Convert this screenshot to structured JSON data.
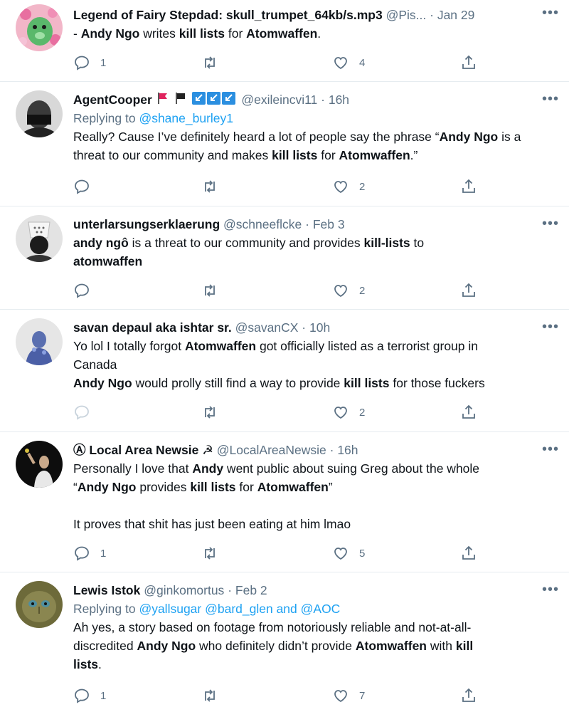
{
  "tweets": [
    {
      "name": "Legend of Fairy Stepdad: skull_trumpet_64kb/s.mp3",
      "handle": "@Pis...",
      "sep": "·",
      "time": "Jan 29",
      "more": "•••",
      "segments": [
        {
          "t": "- ",
          "b": false
        },
        {
          "t": "Andy Ngo",
          "b": true
        },
        {
          "t": " writes ",
          "b": false
        },
        {
          "t": "kill lists",
          "b": true
        },
        {
          "t": " for ",
          "b": false
        },
        {
          "t": "Atomwaffen",
          "b": true
        },
        {
          "t": ".",
          "b": false
        }
      ],
      "replies": "1",
      "retweets": "",
      "likes": "4"
    },
    {
      "name": "AgentCooper",
      "handle": "@exileincvi11",
      "sep": "·",
      "time": "16h",
      "more": "•••",
      "replying_label": "Replying to",
      "replying_to": "@shane_burley1",
      "segments": [
        {
          "t": "Really? Cause I’ve definitely heard a lot of people say the phrase “",
          "b": false
        },
        {
          "t": "Andy Ngo",
          "b": true
        },
        {
          "t": " is a threat to our community and makes ",
          "b": false
        },
        {
          "t": "kill lists",
          "b": true
        },
        {
          "t": " for ",
          "b": false
        },
        {
          "t": "Atomwaffen",
          "b": true
        },
        {
          "t": ".”",
          "b": false
        }
      ],
      "replies": "",
      "retweets": "",
      "likes": "2"
    },
    {
      "name": "unterlarsungserklaerung",
      "handle": "@schneeflcke",
      "sep": "·",
      "time": "Feb 3",
      "more": "•••",
      "segments": [
        {
          "t": "andy ngô",
          "b": true
        },
        {
          "t": " is a threat to our community and provides ",
          "b": false
        },
        {
          "t": "kill-lists",
          "b": true
        },
        {
          "t": " to\n",
          "b": false
        },
        {
          "t": "atomwaffen",
          "b": true
        }
      ],
      "replies": "",
      "retweets": "",
      "likes": "2"
    },
    {
      "name": "savan depaul aka ishtar sr.",
      "handle": "@savanCX",
      "sep": "·",
      "time": "10h",
      "more": "•••",
      "segments": [
        {
          "t": "Yo lol I totally forgot ",
          "b": false
        },
        {
          "t": "Atomwaffen",
          "b": true
        },
        {
          "t": " got officially listed as a terrorist group in\nCanada\n",
          "b": false
        },
        {
          "t": "Andy Ngo",
          "b": true
        },
        {
          "t": " would prolly still find a way to provide ",
          "b": false
        },
        {
          "t": "kill lists",
          "b": true
        },
        {
          "t": " for those fuckers",
          "b": false
        }
      ],
      "replies": "",
      "retweets": "",
      "likes": "2"
    },
    {
      "name": "Ⓐ Local Area Newsie ☭",
      "handle": "@LocalAreaNewsie",
      "sep": "·",
      "time": "16h",
      "more": "•••",
      "segments": [
        {
          "t": "Personally I love that ",
          "b": false
        },
        {
          "t": "Andy",
          "b": true
        },
        {
          "t": " went public about suing Greg about the whole\n“",
          "b": false
        },
        {
          "t": "Andy Ngo",
          "b": true
        },
        {
          "t": " provides ",
          "b": false
        },
        {
          "t": "kill lists",
          "b": true
        },
        {
          "t": " for ",
          "b": false
        },
        {
          "t": "Atomwaffen",
          "b": true
        },
        {
          "t": "”\n\nIt proves that shit has just been eating at him lmao",
          "b": false
        }
      ],
      "replies": "1",
      "retweets": "",
      "likes": "5"
    },
    {
      "name": "Lewis Istok",
      "handle": "@ginkomortus",
      "sep": "·",
      "time": "Feb 2",
      "more": "•••",
      "replying_label": "Replying to",
      "replying_to": "@yallsugar @bard_glen and @AOC",
      "segments": [
        {
          "t": "Ah yes, a story based on footage from notoriously reliable and not-at-all-\ndiscredited ",
          "b": false
        },
        {
          "t": "Andy Ngo",
          "b": true
        },
        {
          "t": " who definitely didn’t provide ",
          "b": false
        },
        {
          "t": "Atomwaffen",
          "b": true
        },
        {
          "t": " with ",
          "b": false
        },
        {
          "t": "kill\nlists",
          "b": true
        },
        {
          "t": ".",
          "b": false
        }
      ],
      "replies": "1",
      "retweets": "",
      "likes": "7"
    }
  ],
  "colors": {
    "accent": "#1da1f2",
    "muted": "#5b7083",
    "text": "#0f1419",
    "divider": "#e6ecf0"
  },
  "icons": [
    "reply-icon",
    "retweet-icon",
    "like-icon",
    "share-icon",
    "more-icon",
    "red-flag-icon",
    "black-flag-icon",
    "blue-arrow-badge-icon"
  ]
}
